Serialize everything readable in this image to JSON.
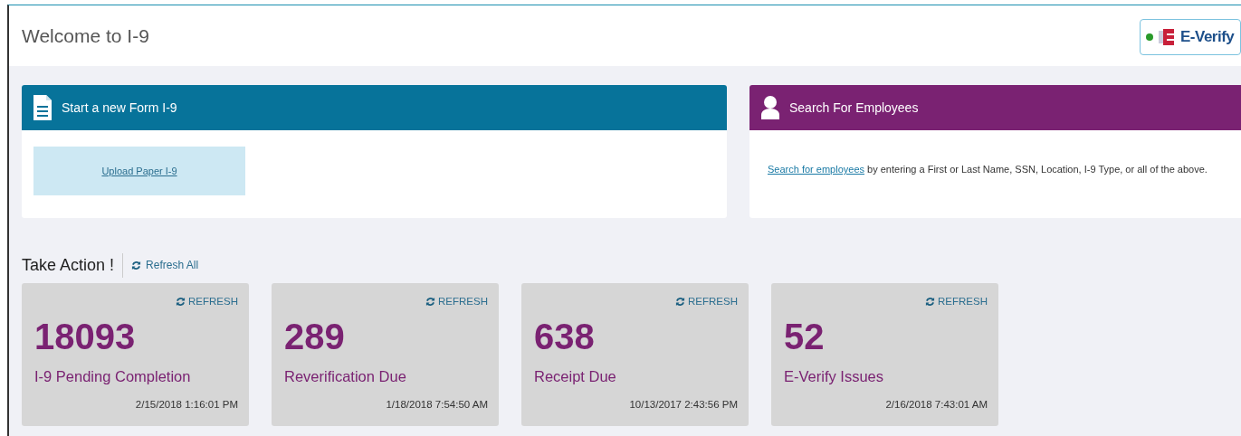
{
  "header": {
    "title": "Welcome to I-9",
    "everify": {
      "label": "E-Verify",
      "connected": true
    }
  },
  "panels": [
    {
      "kind": "form",
      "title": "Start a new Form I-9",
      "link": "Upload Paper I-9"
    },
    {
      "kind": "search",
      "title": "Search For Employees",
      "link": "Search for employees",
      "text": " by entering a First or Last Name, SSN, Location, I-9 Type, or all of the above."
    }
  ],
  "take_action": {
    "title": "Take Action !",
    "refresh_all": "Refresh All"
  },
  "tiles": [
    {
      "refresh": "REFRESH",
      "count": "18093",
      "label": "I-9 Pending Completion",
      "time": "2/15/2018 1:16:01 PM"
    },
    {
      "refresh": "REFRESH",
      "count": "289",
      "label": "Reverification Due",
      "time": "1/18/2018 7:54:50 AM"
    },
    {
      "refresh": "REFRESH",
      "count": "638",
      "label": "Receipt Due",
      "time": "10/13/2017 2:43:56 PM"
    },
    {
      "refresh": "REFRESH",
      "count": "52",
      "label": "E-Verify Issues",
      "time": "2/16/2018 7:43:01 AM"
    }
  ]
}
